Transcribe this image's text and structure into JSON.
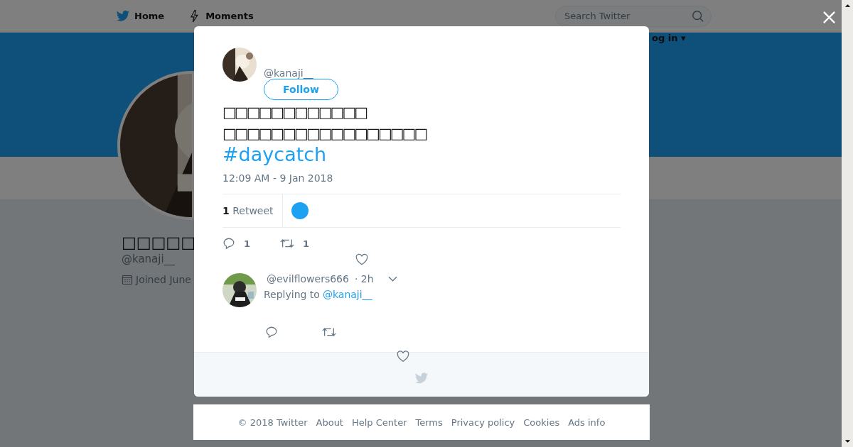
{
  "top_nav": {
    "items": [
      {
        "label": "Home"
      },
      {
        "label": "Moments"
      }
    ],
    "search": {
      "placeholder": "Search Twitter"
    },
    "login": "og in ▾"
  },
  "profile": {
    "name": "□□□□□",
    "handle": "@kanaji__",
    "joined": "Joined June"
  },
  "tweet": {
    "handle": "@kanaji__",
    "follow": "Follow",
    "text_lines": [
      "□□□□□□□□□□□□",
      "□□□□□□□□□□□□□□□□□"
    ],
    "hashtag": "#daycatch",
    "timestamp": "12:09 AM - 9 Jan 2018",
    "stats": "**1** Retweet",
    "replies": "1",
    "retweets": "1"
  },
  "replies": [
    {
      "handle": "@evilflowers666",
      "time": "· 2h",
      "replying_label": "Replying to",
      "replying_to": "@kanaji__"
    }
  ],
  "footer": [
    "© 2018 Twitter",
    "About",
    "Help Center",
    "Terms",
    "Privacy policy",
    "Cookies",
    "Ads info"
  ]
}
